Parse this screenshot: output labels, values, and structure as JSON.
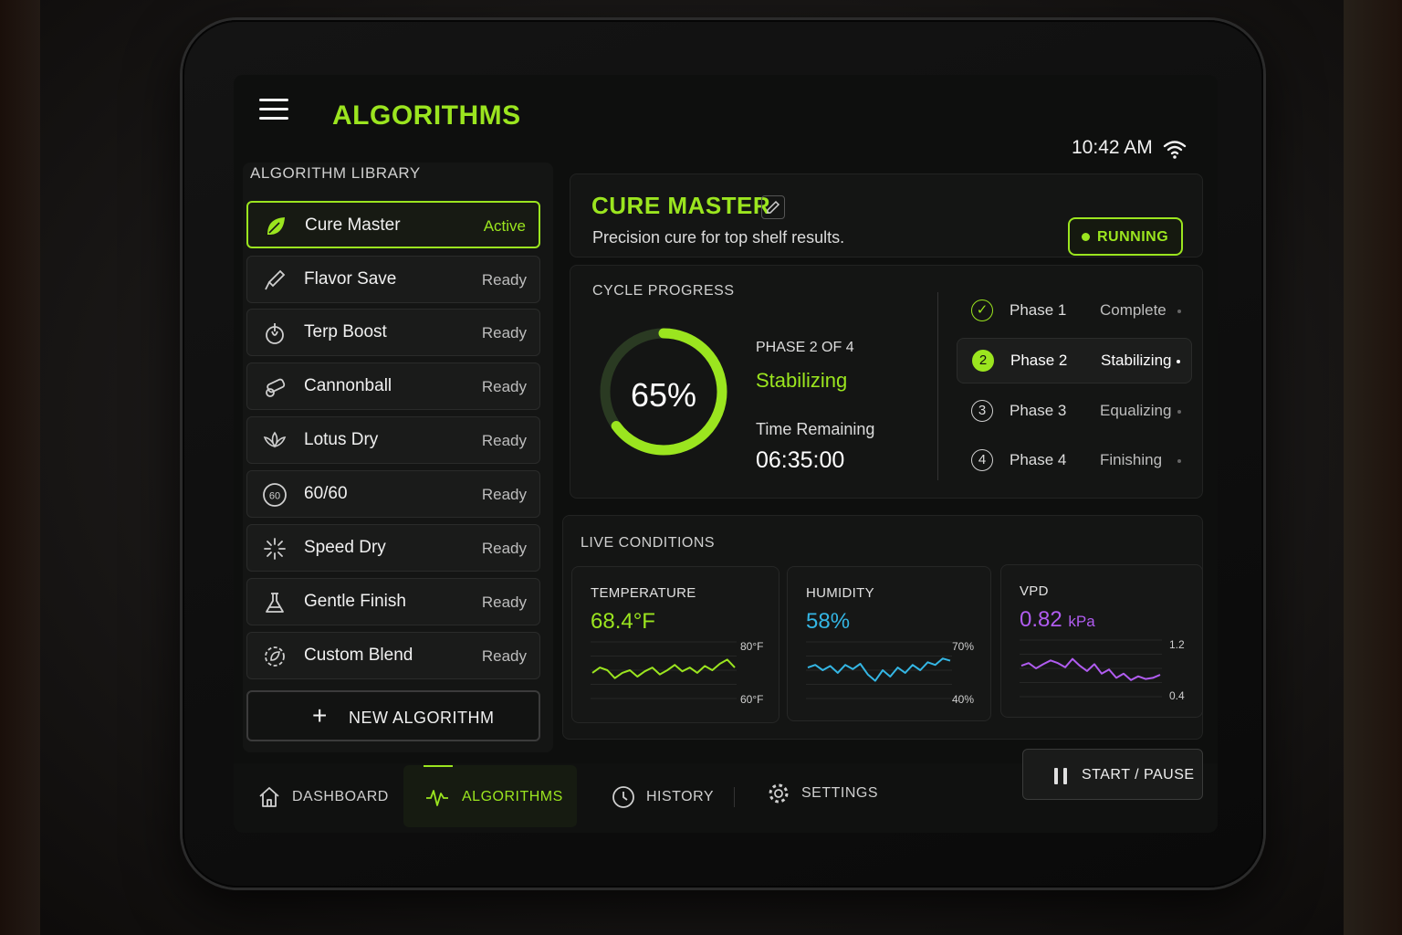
{
  "header": {
    "title": "ALGORITHMS",
    "time": "10:42 AM"
  },
  "library": {
    "title": "ALGORITHM LIBRARY",
    "items": [
      {
        "name": "Cure Master",
        "state": "Active",
        "icon": "leaf-icon"
      },
      {
        "name": "Flavor Save",
        "state": "Ready",
        "icon": "dropper-icon"
      },
      {
        "name": "Terp Boost",
        "state": "Ready",
        "icon": "flask-icon"
      },
      {
        "name": "Cannonball",
        "state": "Ready",
        "icon": "cannon-icon"
      },
      {
        "name": "Lotus Dry",
        "state": "Ready",
        "icon": "lotus-icon"
      },
      {
        "name": "60/60",
        "state": "Ready",
        "icon": "sixty-badge-icon",
        "icon_text": "60"
      },
      {
        "name": "Speed Dry",
        "state": "Ready",
        "icon": "burst-icon"
      },
      {
        "name": "Gentle Finish",
        "state": "Ready",
        "icon": "beaker-icon"
      },
      {
        "name": "Custom Blend",
        "state": "Ready",
        "icon": "gear-leaf-icon"
      }
    ],
    "new_button": "NEW ALGORITHM"
  },
  "current": {
    "name": "CURE MASTER",
    "description": "Precision cure for top shelf results.",
    "status": "RUNNING"
  },
  "cycle": {
    "title": "CYCLE PROGRESS",
    "percent_label": "65%",
    "progress": 0.65,
    "phase_of": "PHASE 2 OF 4",
    "phase_state": "Stabilizing",
    "time_remaining_label": "Time Remaining",
    "time_remaining": "06:35:00",
    "phases": [
      {
        "badge": "✓",
        "name": "Phase 1",
        "state": "Complete",
        "status": "done"
      },
      {
        "badge": "2",
        "name": "Phase 2",
        "state": "Stabilizing",
        "status": "current"
      },
      {
        "badge": "3",
        "name": "Phase 3",
        "state": "Equalizing",
        "status": "pending"
      },
      {
        "badge": "4",
        "name": "Phase 4",
        "state": "Finishing",
        "status": "pending"
      }
    ]
  },
  "live": {
    "title": "LIVE CONDITIONS",
    "metrics": [
      {
        "label": "TEMPERATURE",
        "value": "68.4°F",
        "unit": "",
        "color": "#9be51f",
        "max_label": "80°F",
        "min_label": "60°F",
        "trend": [
          0.45,
          0.55,
          0.5,
          0.35,
          0.45,
          0.5,
          0.38,
          0.48,
          0.55,
          0.42,
          0.5,
          0.6,
          0.48,
          0.55,
          0.45,
          0.58,
          0.5,
          0.62,
          0.7,
          0.55
        ]
      },
      {
        "label": "HUMIDITY",
        "value": "58%",
        "unit": "",
        "color": "#34b6e4",
        "max_label": "70%",
        "min_label": "40%",
        "trend": [
          0.55,
          0.6,
          0.5,
          0.58,
          0.45,
          0.6,
          0.52,
          0.62,
          0.42,
          0.3,
          0.5,
          0.38,
          0.55,
          0.45,
          0.6,
          0.5,
          0.65,
          0.6,
          0.72,
          0.68
        ]
      },
      {
        "label": "VPD",
        "value": "0.82",
        "unit": "kPa",
        "color": "#b05cf0",
        "max_label": "1.2",
        "min_label": "0.4",
        "trend": [
          0.55,
          0.6,
          0.5,
          0.58,
          0.65,
          0.6,
          0.52,
          0.68,
          0.55,
          0.45,
          0.58,
          0.4,
          0.48,
          0.32,
          0.4,
          0.28,
          0.35,
          0.3,
          0.32,
          0.38
        ]
      }
    ]
  },
  "nav": {
    "items": [
      {
        "label": "DASHBOARD"
      },
      {
        "label": "ALGORITHMS"
      },
      {
        "label": "HISTORY"
      },
      {
        "label": "SETTINGS"
      }
    ],
    "start_pause": "START / PAUSE"
  },
  "colors": {
    "accent": "#9be51f",
    "humidity": "#34b6e4",
    "vpd": "#b05cf0"
  }
}
